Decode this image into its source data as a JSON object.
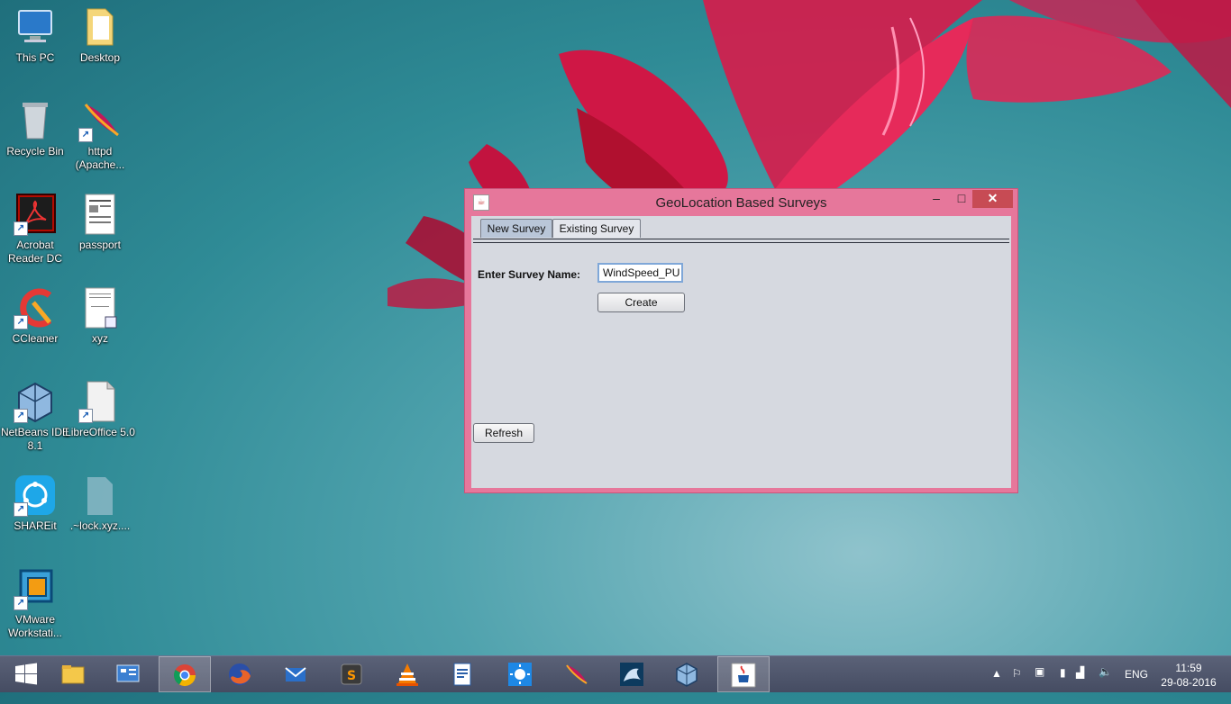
{
  "desktop": {
    "icons": [
      {
        "label": "This PC"
      },
      {
        "label": "Desktop"
      },
      {
        "label": "Recycle Bin"
      },
      {
        "label": "httpd (Apache..."
      },
      {
        "label": "Acrobat Reader DC"
      },
      {
        "label": "passport"
      },
      {
        "label": "CCleaner"
      },
      {
        "label": "xyz"
      },
      {
        "label": "NetBeans IDE 8.1"
      },
      {
        "label": "LibreOffice 5.0"
      },
      {
        "label": "SHAREit"
      },
      {
        "label": ".~lock.xyz...."
      },
      {
        "label": "VMware Workstati..."
      }
    ]
  },
  "window": {
    "title": "GeoLocation Based Surveys",
    "tabs": [
      {
        "label": "New Survey"
      },
      {
        "label": "Existing Survey"
      }
    ],
    "survey_name_label": "Enter Survey Name:",
    "survey_name_value": "WindSpeed_PU",
    "create_label": "Create",
    "refresh_label": "Refresh",
    "controls": {
      "minimize": "–",
      "maximize": "□",
      "close": "✕"
    }
  },
  "taskbar": {
    "apps": [
      "start",
      "file-explorer",
      "control-panel",
      "chrome",
      "firefox",
      "mail",
      "sublime-text",
      "vlc",
      "libreoffice-writer",
      "brightness",
      "apache",
      "mysql",
      "netbeans",
      "java"
    ],
    "tray": {
      "language": "ENG",
      "time": "11:59",
      "date": "29-08-2016"
    }
  }
}
